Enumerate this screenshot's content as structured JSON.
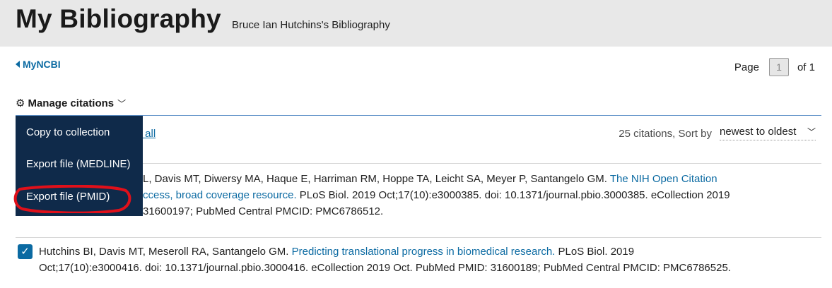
{
  "header": {
    "title": "My Bibliography",
    "subtitle": "Bruce Ian Hutchins's Bibliography"
  },
  "nav": {
    "back_label": "MyNCBI"
  },
  "pager": {
    "page_label": "Page",
    "current_page": "1",
    "of_label": "of 1"
  },
  "manage": {
    "label": "Manage citations",
    "icon": "gear-icon"
  },
  "toolbar": {
    "clear_label": "r all",
    "count_text": "25 citations, Sort by",
    "sort_value": "newest to oldest"
  },
  "menu": {
    "items": [
      "Copy to collection",
      "Export file (MEDLINE)",
      "Export file (PMID)"
    ],
    "highlight_color": "#e0101a"
  },
  "citations": [
    {
      "line1_pre": "L, Davis MT, Diwersy MA, Haque E, Harriman RM, Hoppe TA, Leicht SA, Meyer P, Santangelo GM.",
      "line1_link": "The NIH Open Citation",
      "line2_link": "ccess, broad coverage resource.",
      "line2_post": "PLoS Biol. 2019 Oct;17(10):e3000385. doi: 10.1371/journal.pbio.3000385. eCollection 2019",
      "line3": "31600197; PubMed Central PMCID: PMC6786512."
    },
    {
      "checked": true,
      "line1_pre": "Hutchins BI, Davis MT, Meseroll RA, Santangelo GM.",
      "line1_link": "Predicting translational progress in biomedical research.",
      "line1_post": "PLoS Biol. 2019",
      "line2": "Oct;17(10):e3000416. doi: 10.1371/journal.pbio.3000416. eCollection 2019 Oct. PubMed PMID: 31600189; PubMed Central PMCID: PMC6786525."
    }
  ]
}
